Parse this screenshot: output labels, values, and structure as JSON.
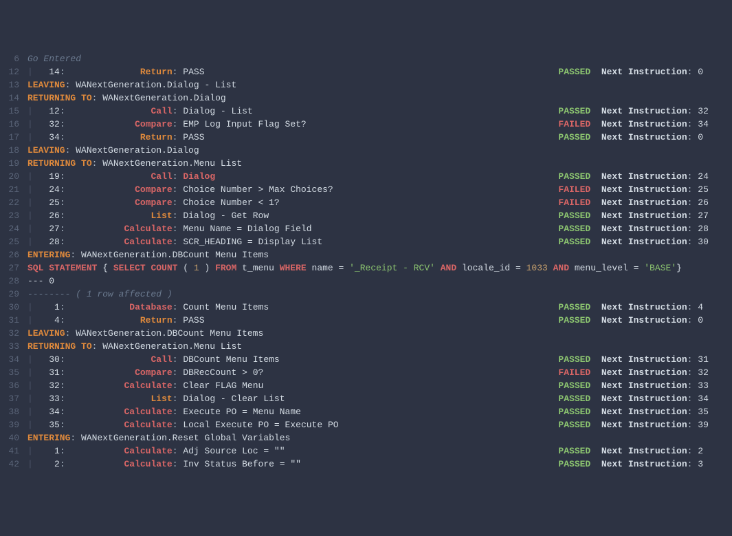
{
  "lines": [
    {
      "num": 6,
      "type": "comment",
      "text": "Go Entered"
    },
    {
      "num": 12,
      "type": "step",
      "lineNo": "14",
      "action": "Return",
      "actionClass": "kw-orange",
      "detail": "PASS",
      "status": "PASSED",
      "next": "0"
    },
    {
      "num": 13,
      "type": "flow",
      "action": "LEAVING",
      "actionClass": "kw-orange",
      "path": "WANextGeneration.Dialog - List"
    },
    {
      "num": 14,
      "type": "flow",
      "action": "RETURNING TO",
      "actionClass": "kw-orange",
      "path": "WANextGeneration.Dialog"
    },
    {
      "num": 15,
      "type": "step",
      "lineNo": "12",
      "action": "Call",
      "actionClass": "kw-red",
      "detail": "Dialog - List",
      "status": "PASSED",
      "next": "32"
    },
    {
      "num": 16,
      "type": "step",
      "lineNo": "32",
      "action": "Compare",
      "actionClass": "kw-red",
      "detail": "EMP Log Input Flag Set?",
      "status": "FAILED",
      "next": "34"
    },
    {
      "num": 17,
      "type": "step",
      "lineNo": "34",
      "action": "Return",
      "actionClass": "kw-orange",
      "detail": "PASS",
      "status": "PASSED",
      "next": "0"
    },
    {
      "num": 18,
      "type": "flow",
      "action": "LEAVING",
      "actionClass": "kw-orange",
      "path": "WANextGeneration.Dialog"
    },
    {
      "num": 19,
      "type": "flow",
      "action": "RETURNING TO",
      "actionClass": "kw-orange",
      "path": "WANextGeneration.Menu List"
    },
    {
      "num": 20,
      "type": "step",
      "lineNo": "19",
      "action": "Call",
      "actionClass": "kw-red",
      "detail": "Dialog",
      "detailClass": "kw-red",
      "status": "PASSED",
      "next": "24"
    },
    {
      "num": 21,
      "type": "step",
      "lineNo": "24",
      "action": "Compare",
      "actionClass": "kw-red",
      "detail": "Choice Number > Max Choices?",
      "status": "FAILED",
      "next": "25"
    },
    {
      "num": 22,
      "type": "step",
      "lineNo": "25",
      "action": "Compare",
      "actionClass": "kw-red",
      "detail": "Choice Number < 1?",
      "status": "FAILED",
      "next": "26"
    },
    {
      "num": 23,
      "type": "step",
      "lineNo": "26",
      "action": "List",
      "actionClass": "kw-orange",
      "detail": "Dialog - Get Row",
      "status": "PASSED",
      "next": "27"
    },
    {
      "num": 24,
      "type": "step",
      "lineNo": "27",
      "action": "Calculate",
      "actionClass": "kw-red",
      "detail": "Menu Name = Dialog Field",
      "status": "PASSED",
      "next": "28"
    },
    {
      "num": 25,
      "type": "step",
      "lineNo": "28",
      "action": "Calculate",
      "actionClass": "kw-red",
      "detail": "SCR_HEADING = Display List",
      "status": "PASSED",
      "next": "30"
    },
    {
      "num": 26,
      "type": "flow",
      "action": "ENTERING",
      "actionClass": "kw-orange",
      "path": "WANextGeneration.DBCount Menu Items"
    },
    {
      "num": 27,
      "type": "sql"
    },
    {
      "num": 28,
      "type": "plain",
      "text": "--- 0"
    },
    {
      "num": 29,
      "type": "plain-italic",
      "text": "-------- ( 1 row affected )"
    },
    {
      "num": 30,
      "type": "step",
      "lineNo": "1",
      "action": "Database",
      "actionClass": "kw-red",
      "detail": "Count Menu Items",
      "status": "PASSED",
      "next": "4"
    },
    {
      "num": 31,
      "type": "step",
      "lineNo": "4",
      "action": "Return",
      "actionClass": "kw-orange",
      "detail": "PASS",
      "status": "PASSED",
      "next": "0"
    },
    {
      "num": 32,
      "type": "flow",
      "action": "LEAVING",
      "actionClass": "kw-orange",
      "path": "WANextGeneration.DBCount Menu Items"
    },
    {
      "num": 33,
      "type": "flow",
      "action": "RETURNING TO",
      "actionClass": "kw-orange",
      "path": "WANextGeneration.Menu List"
    },
    {
      "num": 34,
      "type": "step",
      "lineNo": "30",
      "action": "Call",
      "actionClass": "kw-red",
      "detail": "DBCount Menu Items",
      "status": "PASSED",
      "next": "31"
    },
    {
      "num": 35,
      "type": "step",
      "lineNo": "31",
      "action": "Compare",
      "actionClass": "kw-red",
      "detail": "DBRecCount > 0?",
      "status": "FAILED",
      "next": "32"
    },
    {
      "num": 36,
      "type": "step",
      "lineNo": "32",
      "action": "Calculate",
      "actionClass": "kw-red",
      "detail": "Clear FLAG Menu",
      "status": "PASSED",
      "next": "33"
    },
    {
      "num": 37,
      "type": "step",
      "lineNo": "33",
      "action": "List",
      "actionClass": "kw-orange",
      "detail": "Dialog - Clear List",
      "status": "PASSED",
      "next": "34"
    },
    {
      "num": 38,
      "type": "step",
      "lineNo": "34",
      "action": "Calculate",
      "actionClass": "kw-red",
      "detail": "Execute PO = Menu Name",
      "status": "PASSED",
      "next": "35"
    },
    {
      "num": 39,
      "type": "step",
      "lineNo": "35",
      "action": "Calculate",
      "actionClass": "kw-red",
      "detail": "Local Execute PO = Execute PO",
      "status": "PASSED",
      "next": "39"
    },
    {
      "num": 40,
      "type": "flow",
      "action": "ENTERING",
      "actionClass": "kw-orange",
      "path": "WANextGeneration.Reset Global Variables"
    },
    {
      "num": 41,
      "type": "step",
      "lineNo": "1",
      "action": "Calculate",
      "actionClass": "kw-red",
      "detail": "Adj Source Loc = \"\"",
      "status": "PASSED",
      "next": "2"
    },
    {
      "num": 42,
      "type": "step",
      "lineNo": "2",
      "action": "Calculate",
      "actionClass": "kw-red",
      "detail": "Inv Status Before = \"\"",
      "status": "PASSED",
      "next": "3"
    }
  ],
  "sql": {
    "prefix": "SQL STATEMENT ",
    "brace_open": "{ ",
    "select": "SELECT ",
    "count": "COUNT ",
    "p1": "( ",
    "one": "1 ",
    "p2": ") ",
    "from": "FROM ",
    "tbl": "t_menu ",
    "where": "WHERE ",
    "name_eq": "name = ",
    "str1": "'_Receipt - RCV' ",
    "and1": "AND ",
    "loc": "locale_id = ",
    "n1033": "1033 ",
    "and2": "AND ",
    "ml": "menu_level = ",
    "str2": "'BASE'",
    "brace_close": "}"
  },
  "labels": {
    "next_instruction": "Next Instruction",
    "passed": "PASSED",
    "failed": "FAILED"
  }
}
